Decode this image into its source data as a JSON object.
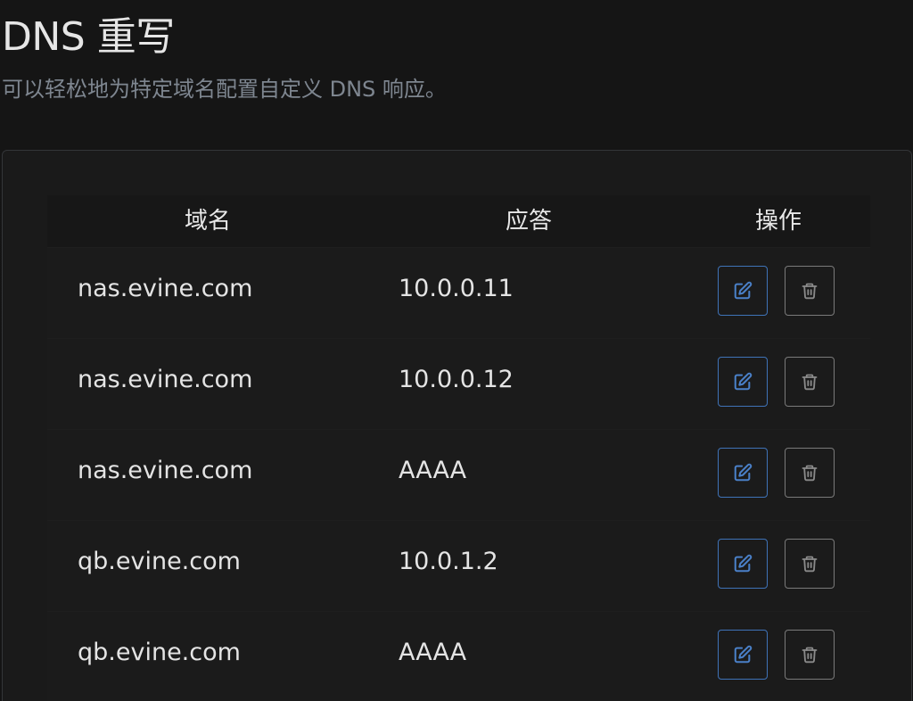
{
  "header": {
    "title": "DNS 重写",
    "subtitle": "可以轻松地为特定域名配置自定义 DNS 响应。"
  },
  "table": {
    "columns": {
      "domain": "域名",
      "answer": "应答",
      "actions": "操作"
    },
    "rows": [
      {
        "domain": "nas.evine.com",
        "answer": "10.0.0.11"
      },
      {
        "domain": "nas.evine.com",
        "answer": "10.0.0.12"
      },
      {
        "domain": "nas.evine.com",
        "answer": "AAAA"
      },
      {
        "domain": "qb.evine.com",
        "answer": "10.0.1.2"
      },
      {
        "domain": "qb.evine.com",
        "answer": "AAAA"
      }
    ]
  },
  "icons": {
    "edit": "edit-icon",
    "delete": "trash-icon"
  },
  "colors": {
    "background": "#141414",
    "card": "#1a1a1a",
    "edit_accent": "#3f73b8",
    "delete_border": "#7a7a7a"
  }
}
